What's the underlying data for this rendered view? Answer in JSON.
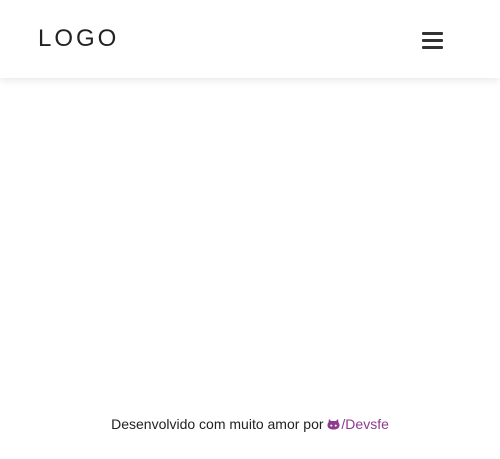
{
  "header": {
    "logo_text": "LOGO",
    "menu_icon": "hamburger-menu-icon"
  },
  "footer": {
    "text": "Desenvolvido com muito amor por",
    "link_text": "/Devsfe",
    "link_icon": "github-icon",
    "link_color": "#8e3b8e"
  }
}
